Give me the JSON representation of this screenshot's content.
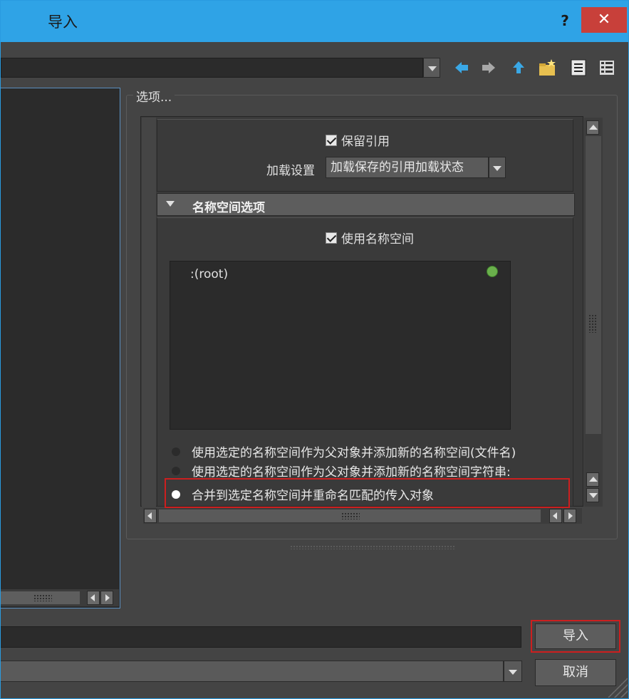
{
  "window": {
    "title": "导入",
    "help_label": "?",
    "close_label": "✕"
  },
  "toolbar": {
    "icons": [
      "back-arrow-icon",
      "forward-arrow-icon",
      "up-folder-icon",
      "new-folder-icon",
      "list-view-icon",
      "detail-view-icon"
    ]
  },
  "options": {
    "legend": "选项...",
    "keep_references": {
      "label": "保留引用",
      "checked": true
    },
    "load_settings": {
      "label": "加载设置",
      "value": "加载保存的引用加载状态"
    },
    "namespace_section": {
      "title": "名称空间选项",
      "use_namespaces": {
        "label": "使用名称空间",
        "checked": true
      },
      "namespace_list": [
        ":(root)"
      ],
      "radio_options": [
        {
          "label": "使用选定的名称空间作为父对象并添加新的名称空间(文件名)",
          "selected": false
        },
        {
          "label": "使用选定的名称空间作为父对象并添加新的名称空间字符串:",
          "selected": false
        },
        {
          "label": "合并到选定名称空间并重命名匹配的传入对象",
          "selected": true
        }
      ]
    }
  },
  "buttons": {
    "import_label": "导入",
    "cancel_label": "取消"
  },
  "colors": {
    "titlebar": "#2fa3e6",
    "close": "#c8403a",
    "highlight": "#cc1f1f",
    "status_dot": "#6ab04c"
  }
}
